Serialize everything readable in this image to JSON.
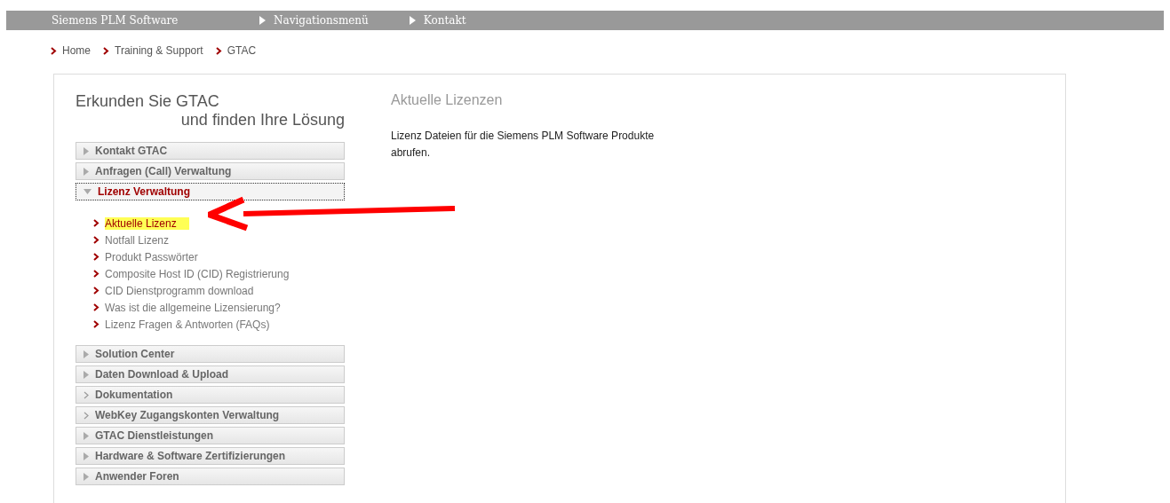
{
  "top_bar": {
    "brand": "Siemens PLM Software",
    "links": [
      "Navigationsmenü",
      "Kontakt"
    ]
  },
  "breadcrumb": [
    "Home",
    "Training & Support",
    "GTAC"
  ],
  "sidebar": {
    "title_line1": "Erkunden Sie GTAC",
    "title_line2": "und finden Ihre Lösung",
    "sections": [
      {
        "label": "Kontakt GTAC",
        "kind": "triangle",
        "expanded": false
      },
      {
        "label": "Anfragen (Call) Verwaltung",
        "kind": "triangle",
        "expanded": false
      },
      {
        "label": "Lizenz Verwaltung",
        "kind": "triangle",
        "expanded": true,
        "children": [
          {
            "label": "Aktuelle Lizenz",
            "highlighted": true
          },
          {
            "label": "Notfall Lizenz",
            "highlighted": false
          },
          {
            "label": "Produkt Passwörter",
            "highlighted": false
          },
          {
            "label": "Composite Host ID (CID) Registrierung",
            "highlighted": false
          },
          {
            "label": "CID Dienstprogramm download",
            "highlighted": false
          },
          {
            "label": "Was ist die allgemeine Lizensierung?",
            "highlighted": false
          },
          {
            "label": "Lizenz Fragen & Antworten (FAQs)",
            "highlighted": false
          }
        ]
      },
      {
        "label": "Solution Center",
        "kind": "triangle",
        "expanded": false
      },
      {
        "label": "Daten Download & Upload",
        "kind": "triangle",
        "expanded": false
      },
      {
        "label": "Dokumentation",
        "kind": "chevron",
        "expanded": false
      },
      {
        "label": "WebKey Zugangskonten Verwaltung",
        "kind": "chevron",
        "expanded": false
      },
      {
        "label": "GTAC Dienstleistungen",
        "kind": "triangle",
        "expanded": false
      },
      {
        "label": "Hardware & Software Zertifizierungen",
        "kind": "triangle",
        "expanded": false
      },
      {
        "label": "Anwender Foren",
        "kind": "triangle",
        "expanded": false
      }
    ]
  },
  "content": {
    "heading": "Aktuelle Lizenzen",
    "text": "Lizenz Dateien für die Siemens PLM Software Produkte abrufen."
  }
}
